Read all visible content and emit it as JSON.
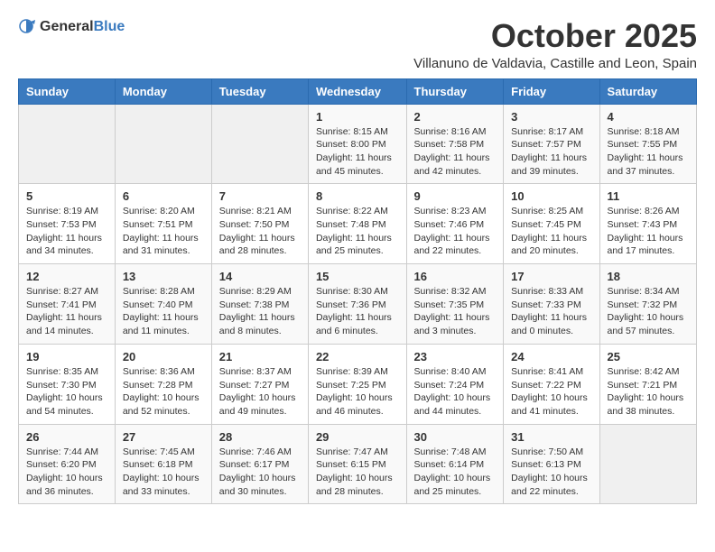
{
  "logo": {
    "general": "General",
    "blue": "Blue"
  },
  "title": "October 2025",
  "location": "Villanuno de Valdavia, Castille and Leon, Spain",
  "days_of_week": [
    "Sunday",
    "Monday",
    "Tuesday",
    "Wednesday",
    "Thursday",
    "Friday",
    "Saturday"
  ],
  "weeks": [
    [
      {
        "day": "",
        "info": ""
      },
      {
        "day": "",
        "info": ""
      },
      {
        "day": "",
        "info": ""
      },
      {
        "day": "1",
        "info": "Sunrise: 8:15 AM\nSunset: 8:00 PM\nDaylight: 11 hours\nand 45 minutes."
      },
      {
        "day": "2",
        "info": "Sunrise: 8:16 AM\nSunset: 7:58 PM\nDaylight: 11 hours\nand 42 minutes."
      },
      {
        "day": "3",
        "info": "Sunrise: 8:17 AM\nSunset: 7:57 PM\nDaylight: 11 hours\nand 39 minutes."
      },
      {
        "day": "4",
        "info": "Sunrise: 8:18 AM\nSunset: 7:55 PM\nDaylight: 11 hours\nand 37 minutes."
      }
    ],
    [
      {
        "day": "5",
        "info": "Sunrise: 8:19 AM\nSunset: 7:53 PM\nDaylight: 11 hours\nand 34 minutes."
      },
      {
        "day": "6",
        "info": "Sunrise: 8:20 AM\nSunset: 7:51 PM\nDaylight: 11 hours\nand 31 minutes."
      },
      {
        "day": "7",
        "info": "Sunrise: 8:21 AM\nSunset: 7:50 PM\nDaylight: 11 hours\nand 28 minutes."
      },
      {
        "day": "8",
        "info": "Sunrise: 8:22 AM\nSunset: 7:48 PM\nDaylight: 11 hours\nand 25 minutes."
      },
      {
        "day": "9",
        "info": "Sunrise: 8:23 AM\nSunset: 7:46 PM\nDaylight: 11 hours\nand 22 minutes."
      },
      {
        "day": "10",
        "info": "Sunrise: 8:25 AM\nSunset: 7:45 PM\nDaylight: 11 hours\nand 20 minutes."
      },
      {
        "day": "11",
        "info": "Sunrise: 8:26 AM\nSunset: 7:43 PM\nDaylight: 11 hours\nand 17 minutes."
      }
    ],
    [
      {
        "day": "12",
        "info": "Sunrise: 8:27 AM\nSunset: 7:41 PM\nDaylight: 11 hours\nand 14 minutes."
      },
      {
        "day": "13",
        "info": "Sunrise: 8:28 AM\nSunset: 7:40 PM\nDaylight: 11 hours\nand 11 minutes."
      },
      {
        "day": "14",
        "info": "Sunrise: 8:29 AM\nSunset: 7:38 PM\nDaylight: 11 hours\nand 8 minutes."
      },
      {
        "day": "15",
        "info": "Sunrise: 8:30 AM\nSunset: 7:36 PM\nDaylight: 11 hours\nand 6 minutes."
      },
      {
        "day": "16",
        "info": "Sunrise: 8:32 AM\nSunset: 7:35 PM\nDaylight: 11 hours\nand 3 minutes."
      },
      {
        "day": "17",
        "info": "Sunrise: 8:33 AM\nSunset: 7:33 PM\nDaylight: 11 hours\nand 0 minutes."
      },
      {
        "day": "18",
        "info": "Sunrise: 8:34 AM\nSunset: 7:32 PM\nDaylight: 10 hours\nand 57 minutes."
      }
    ],
    [
      {
        "day": "19",
        "info": "Sunrise: 8:35 AM\nSunset: 7:30 PM\nDaylight: 10 hours\nand 54 minutes."
      },
      {
        "day": "20",
        "info": "Sunrise: 8:36 AM\nSunset: 7:28 PM\nDaylight: 10 hours\nand 52 minutes."
      },
      {
        "day": "21",
        "info": "Sunrise: 8:37 AM\nSunset: 7:27 PM\nDaylight: 10 hours\nand 49 minutes."
      },
      {
        "day": "22",
        "info": "Sunrise: 8:39 AM\nSunset: 7:25 PM\nDaylight: 10 hours\nand 46 minutes."
      },
      {
        "day": "23",
        "info": "Sunrise: 8:40 AM\nSunset: 7:24 PM\nDaylight: 10 hours\nand 44 minutes."
      },
      {
        "day": "24",
        "info": "Sunrise: 8:41 AM\nSunset: 7:22 PM\nDaylight: 10 hours\nand 41 minutes."
      },
      {
        "day": "25",
        "info": "Sunrise: 8:42 AM\nSunset: 7:21 PM\nDaylight: 10 hours\nand 38 minutes."
      }
    ],
    [
      {
        "day": "26",
        "info": "Sunrise: 7:44 AM\nSunset: 6:20 PM\nDaylight: 10 hours\nand 36 minutes."
      },
      {
        "day": "27",
        "info": "Sunrise: 7:45 AM\nSunset: 6:18 PM\nDaylight: 10 hours\nand 33 minutes."
      },
      {
        "day": "28",
        "info": "Sunrise: 7:46 AM\nSunset: 6:17 PM\nDaylight: 10 hours\nand 30 minutes."
      },
      {
        "day": "29",
        "info": "Sunrise: 7:47 AM\nSunset: 6:15 PM\nDaylight: 10 hours\nand 28 minutes."
      },
      {
        "day": "30",
        "info": "Sunrise: 7:48 AM\nSunset: 6:14 PM\nDaylight: 10 hours\nand 25 minutes."
      },
      {
        "day": "31",
        "info": "Sunrise: 7:50 AM\nSunset: 6:13 PM\nDaylight: 10 hours\nand 22 minutes."
      },
      {
        "day": "",
        "info": ""
      }
    ]
  ]
}
